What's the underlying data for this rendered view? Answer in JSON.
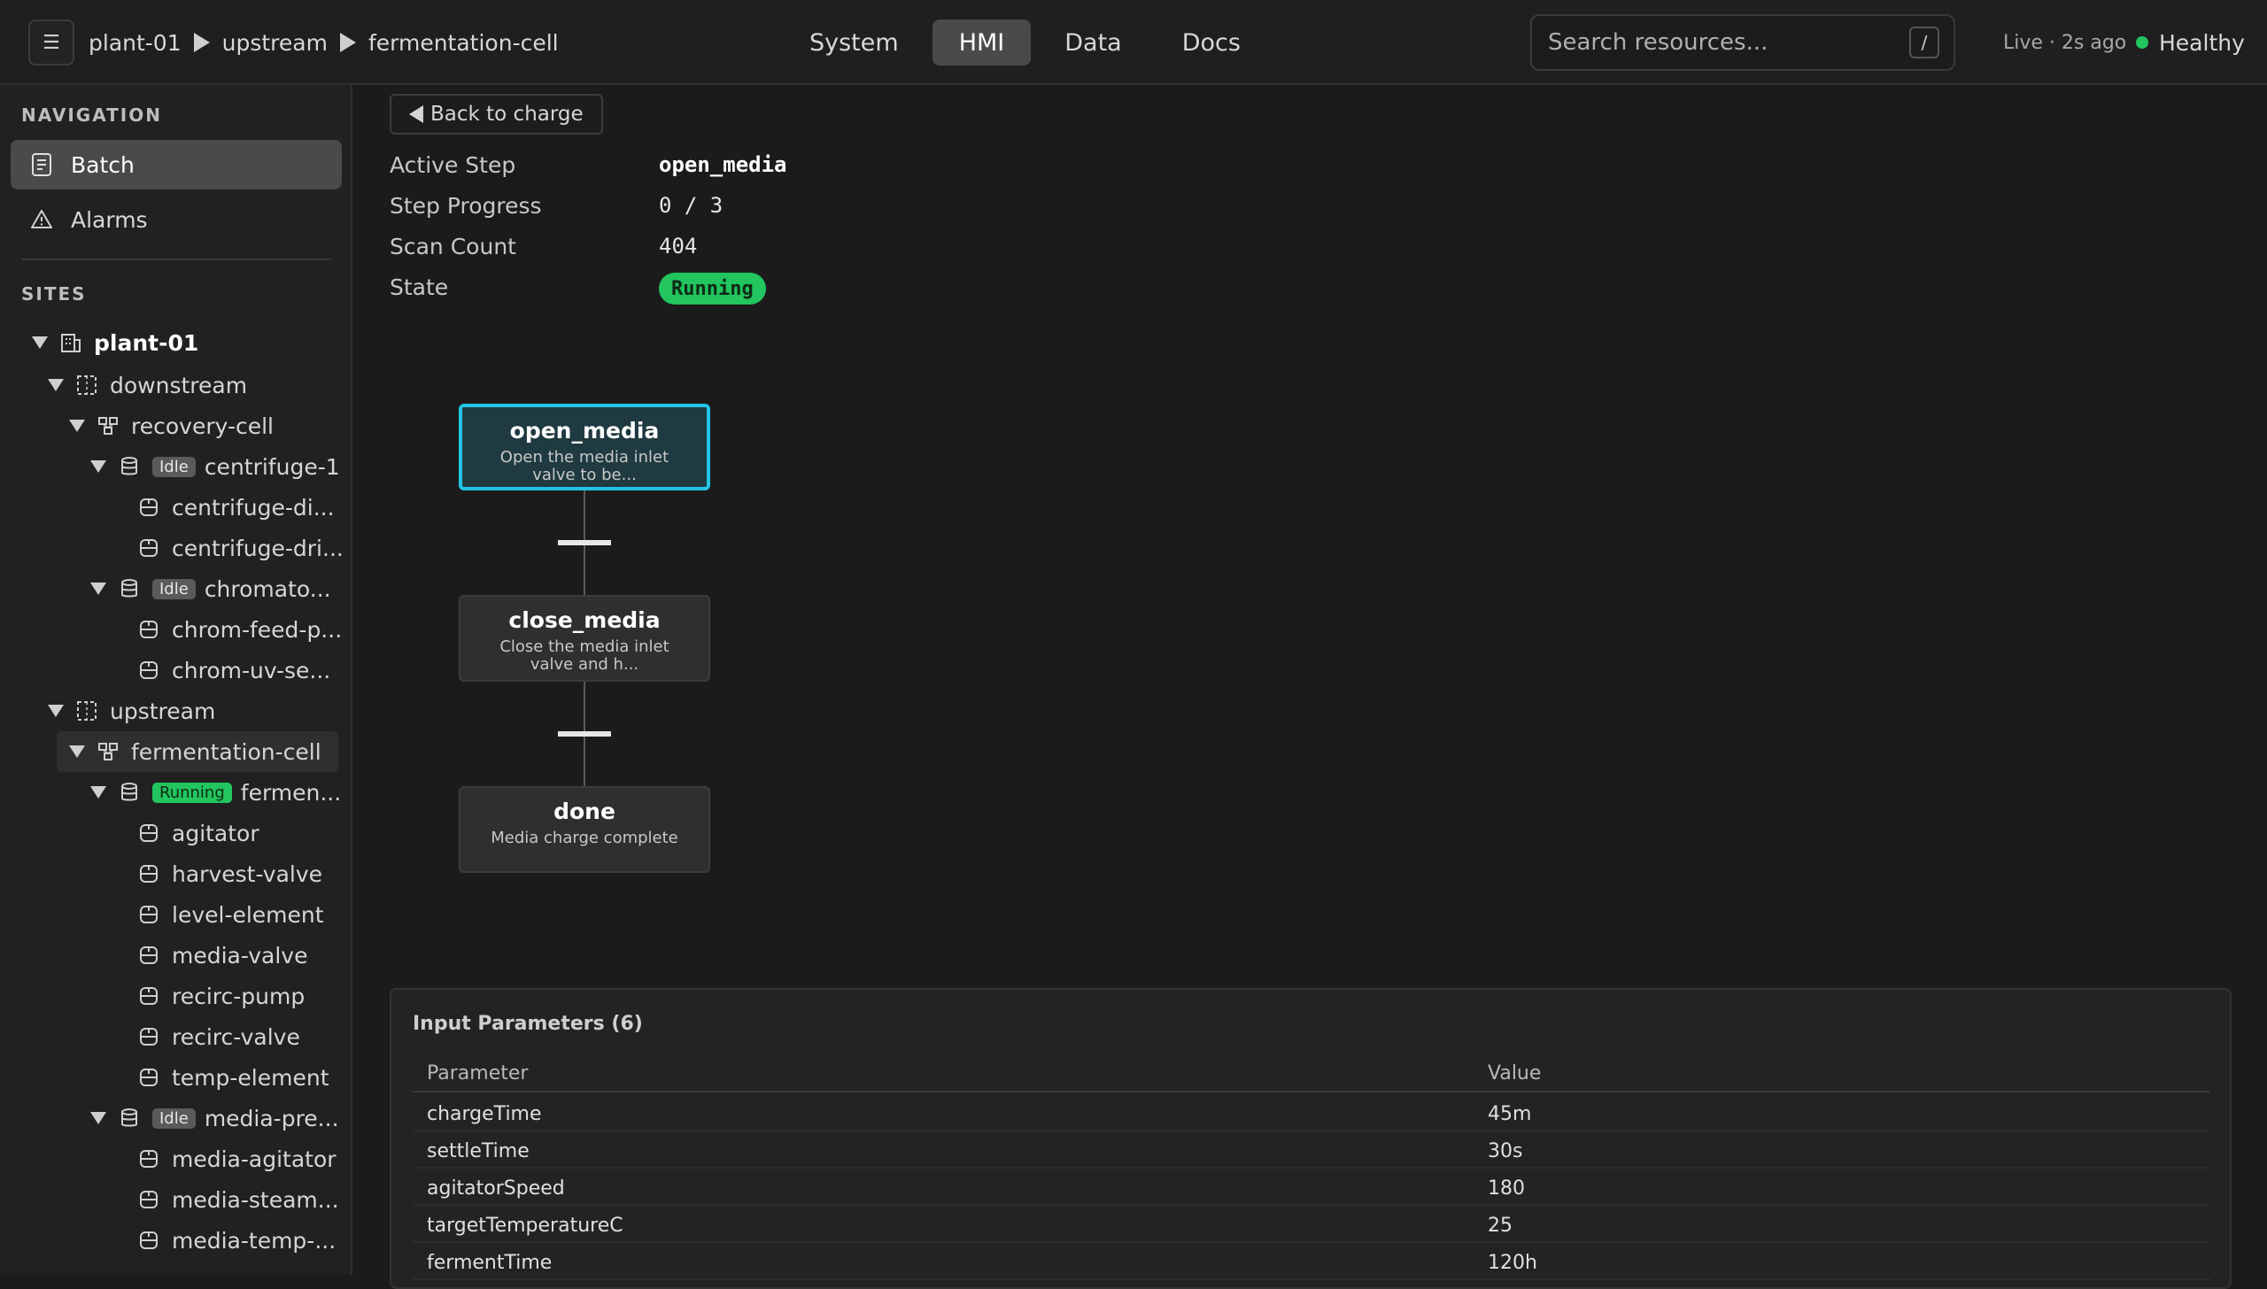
{
  "breadcrumbs": [
    "plant-01",
    "upstream",
    "fermentation-cell"
  ],
  "nav_tabs": [
    {
      "label": "System",
      "active": false
    },
    {
      "label": "HMI",
      "active": true
    },
    {
      "label": "Data",
      "active": false
    },
    {
      "label": "Docs",
      "active": false
    }
  ],
  "search": {
    "placeholder": "Search resources...",
    "shortcut": "/"
  },
  "status": {
    "live": "Live · 2s ago",
    "health": "Healthy"
  },
  "sidebar": {
    "nav_label": "NAVIGATION",
    "nav_items": [
      {
        "label": "Batch",
        "icon": "document-icon",
        "active": true
      },
      {
        "label": "Alarms",
        "icon": "warning-icon",
        "active": false
      }
    ],
    "sites_label": "SITES",
    "tree": [
      {
        "label": "plant-01",
        "type": "site"
      },
      {
        "label": "downstream",
        "type": "area"
      },
      {
        "label": "recovery-cell",
        "type": "cell"
      },
      {
        "label": "centrifuge-1",
        "type": "unit",
        "badge": "Idle"
      },
      {
        "label": "centrifuge-di...",
        "type": "device"
      },
      {
        "label": "centrifuge-dri...",
        "type": "device"
      },
      {
        "label": "chromato...",
        "type": "unit",
        "badge": "Idle"
      },
      {
        "label": "chrom-feed-p...",
        "type": "device"
      },
      {
        "label": "chrom-uv-se...",
        "type": "device"
      },
      {
        "label": "upstream",
        "type": "area"
      },
      {
        "label": "fermentation-cell",
        "type": "cell",
        "selected": true
      },
      {
        "label": "fermen...",
        "type": "unit",
        "badge": "Running"
      },
      {
        "label": "agitator",
        "type": "device"
      },
      {
        "label": "harvest-valve",
        "type": "device"
      },
      {
        "label": "level-element",
        "type": "device"
      },
      {
        "label": "media-valve",
        "type": "device"
      },
      {
        "label": "recirc-pump",
        "type": "device"
      },
      {
        "label": "recirc-valve",
        "type": "device"
      },
      {
        "label": "temp-element",
        "type": "device"
      },
      {
        "label": "media-pre...",
        "type": "unit",
        "badge": "Idle"
      },
      {
        "label": "media-agitator",
        "type": "device"
      },
      {
        "label": "media-steam...",
        "type": "device"
      },
      {
        "label": "media-temp-...",
        "type": "device"
      }
    ]
  },
  "main": {
    "back_label": "Back to charge",
    "fields": [
      {
        "label": "Active Step",
        "value": "open_media"
      },
      {
        "label": "Step Progress",
        "value": "0 / 3"
      },
      {
        "label": "Scan Count",
        "value": "404"
      },
      {
        "label": "State",
        "value": "Running"
      }
    ],
    "steps": [
      {
        "title": "open_media",
        "desc": "Open the media inlet valve to be...",
        "active": true
      },
      {
        "title": "close_media",
        "desc": "Close the media inlet valve and h...",
        "active": false
      },
      {
        "title": "done",
        "desc": "Media charge complete",
        "active": false
      }
    ],
    "params": {
      "title": "Input Parameters (6)",
      "headers": [
        "Parameter",
        "Value"
      ],
      "rows": [
        [
          "chargeTime",
          "45m"
        ],
        [
          "settleTime",
          "30s"
        ],
        [
          "agitatorSpeed",
          "180"
        ],
        [
          "targetTemperatureC",
          "25"
        ],
        [
          "fermentTime",
          "120h"
        ]
      ]
    }
  },
  "colors": {
    "accent": "#22c4e6",
    "running": "#22c55e",
    "idle": "#5a5a5a"
  }
}
